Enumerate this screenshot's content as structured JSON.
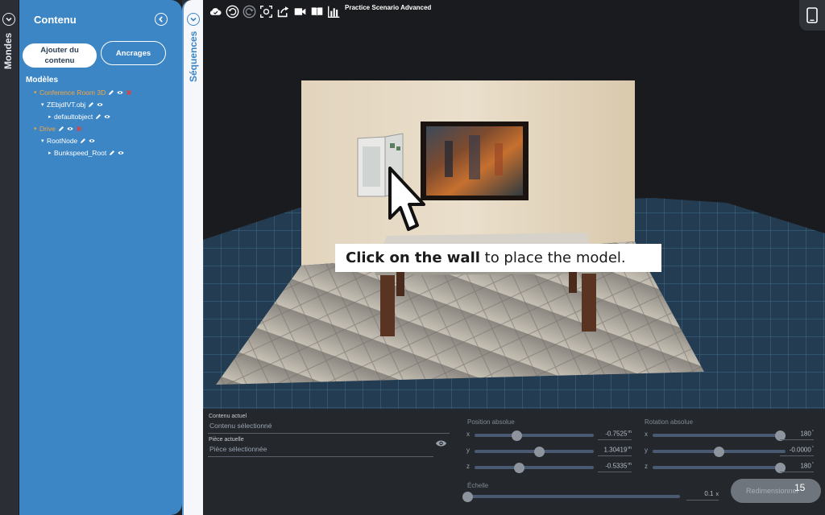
{
  "mondes": {
    "label": "Mondes"
  },
  "content_panel": {
    "title": "Contenu",
    "add_button": "Ajouter du contenu",
    "anchors_button": "Ancrages",
    "models_heading": "Modèles",
    "tree": [
      {
        "label": "Conference Room 3D",
        "level": 0,
        "highlight": true,
        "edit": true,
        "view": true,
        "delete": true
      },
      {
        "label": "ZEbjdIVT.obj",
        "level": 1,
        "highlight": false,
        "edit": true,
        "view": true,
        "delete": false
      },
      {
        "label": "defaultobject",
        "level": 2,
        "highlight": false,
        "edit": true,
        "view": true,
        "delete": false
      },
      {
        "label": "Drive",
        "level": 0,
        "highlight": true,
        "edit": true,
        "view": true,
        "delete": true
      },
      {
        "label": "RootNode",
        "level": 1,
        "highlight": false,
        "edit": true,
        "view": true,
        "delete": false
      },
      {
        "label": "Bunkspeed_Root",
        "level": 2,
        "highlight": false,
        "edit": true,
        "view": true,
        "delete": false
      }
    ]
  },
  "sequences": {
    "label": "Séquences"
  },
  "toolbar": {
    "icons": [
      "cloud-save-icon",
      "undo-icon",
      "redo-icon",
      "focus-icon",
      "share-icon",
      "video-icon",
      "book-icon",
      "stats-icon"
    ],
    "scenario_title": "Practice Scenario Advanced"
  },
  "tooltip": {
    "bold": "Click on the wall",
    "rest": " to place the model."
  },
  "bottom": {
    "current_content_label": "Contenu actuel",
    "current_content_value": "Contenu sélectionné",
    "current_room_label": "Pièce actuelle",
    "current_room_value": "Pièce sélectionnée",
    "position_label": "Position absolue",
    "rotation_label": "Rotation absolue",
    "scale_label": "Échelle",
    "position": [
      {
        "axis": "x",
        "value": "-0.7525",
        "unit": "m",
        "level": 0.34
      },
      {
        "axis": "y",
        "value": "1.30419",
        "unit": "m",
        "level": 0.55
      },
      {
        "axis": "z",
        "value": "-0.5335",
        "unit": "m",
        "level": 0.36
      }
    ],
    "rotation": [
      {
        "axis": "x",
        "value": "180",
        "unit": "°",
        "level": 1.0
      },
      {
        "axis": "y",
        "value": "-0.0000",
        "unit": "°",
        "level": 0.5
      },
      {
        "axis": "z",
        "value": "180",
        "unit": "°",
        "level": 1.0
      }
    ],
    "scale": {
      "value": "0.1",
      "unit": "x",
      "level": 0.0
    },
    "resize_button": "Redimensionner",
    "page_number": "15"
  }
}
